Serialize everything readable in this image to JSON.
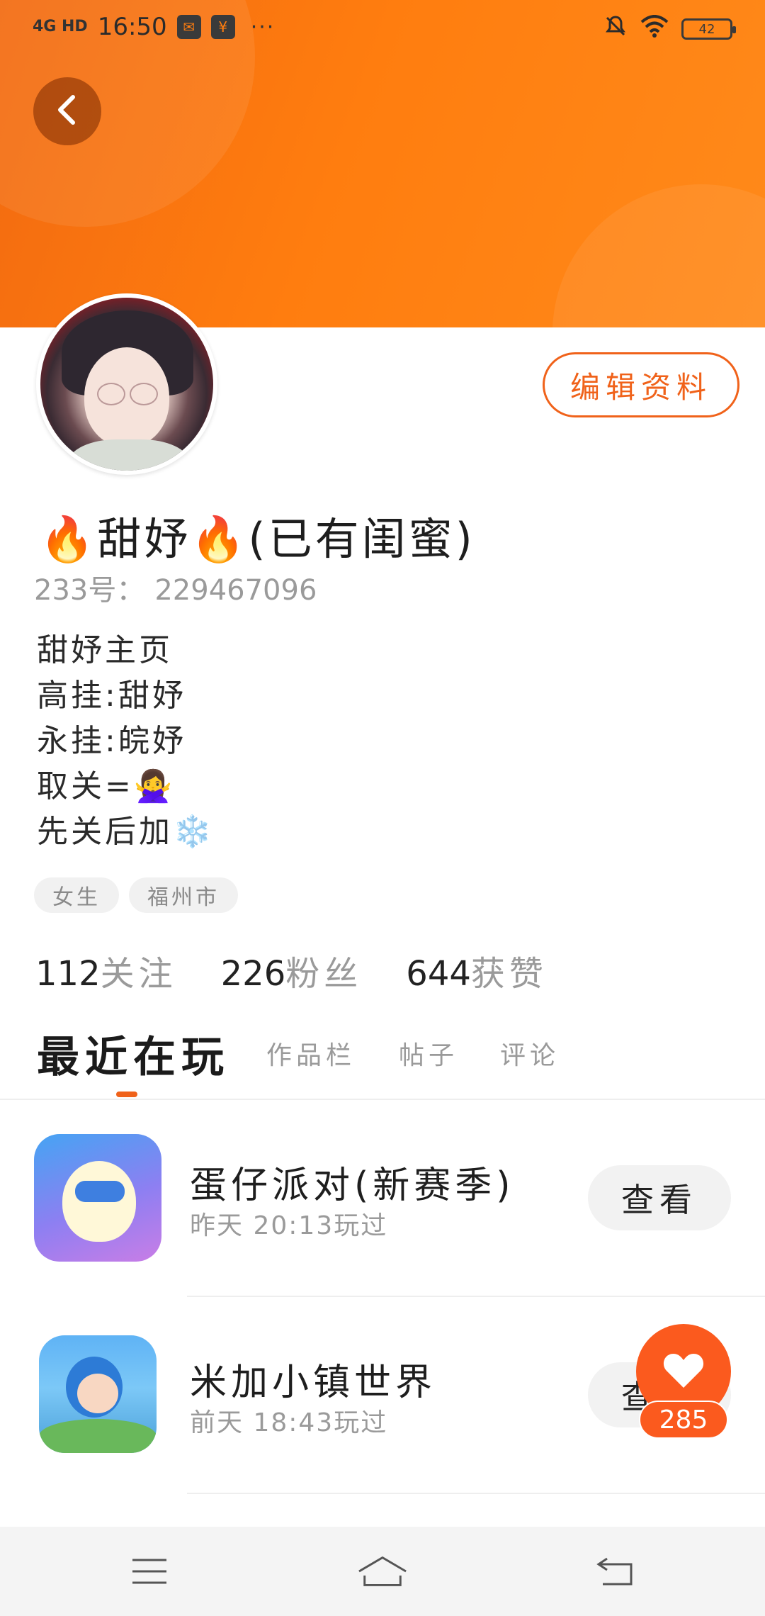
{
  "status_bar": {
    "network": "4G HD",
    "time": "16:50",
    "more": "···",
    "battery": "42"
  },
  "profile": {
    "nickname": "🔥甜妤🔥(已有闺蜜)",
    "uid_label": "233号：",
    "uid": "229467096",
    "edit_label": "编辑资料",
    "bio": [
      "甜妤主页",
      "高挂:甜妤",
      "永挂:皖妤",
      "取关=🙅‍♀️",
      "先关后加❄️"
    ],
    "tags": [
      "女生",
      "福州市"
    ],
    "stats": [
      {
        "num": "112",
        "label": "关注"
      },
      {
        "num": "226",
        "label": "粉丝"
      },
      {
        "num": "644",
        "label": "获赞"
      }
    ]
  },
  "tabs": [
    "最近在玩",
    "作品栏",
    "帖子",
    "评论"
  ],
  "games": [
    {
      "title": "蛋仔派对(新赛季)",
      "played": "昨天 20:13玩过",
      "button": "查看"
    },
    {
      "title": "米加小镇世界",
      "played": "前天 18:43玩过",
      "button": "查看"
    }
  ],
  "like": {
    "count": "285"
  },
  "icons": {
    "back": "chevron-left-icon",
    "like": "heart-icon",
    "nav_menu": "menu-icon",
    "nav_home": "home-icon",
    "nav_back": "back-icon"
  },
  "colors": {
    "accent": "#f0621a",
    "header": "#ff7d0f"
  }
}
